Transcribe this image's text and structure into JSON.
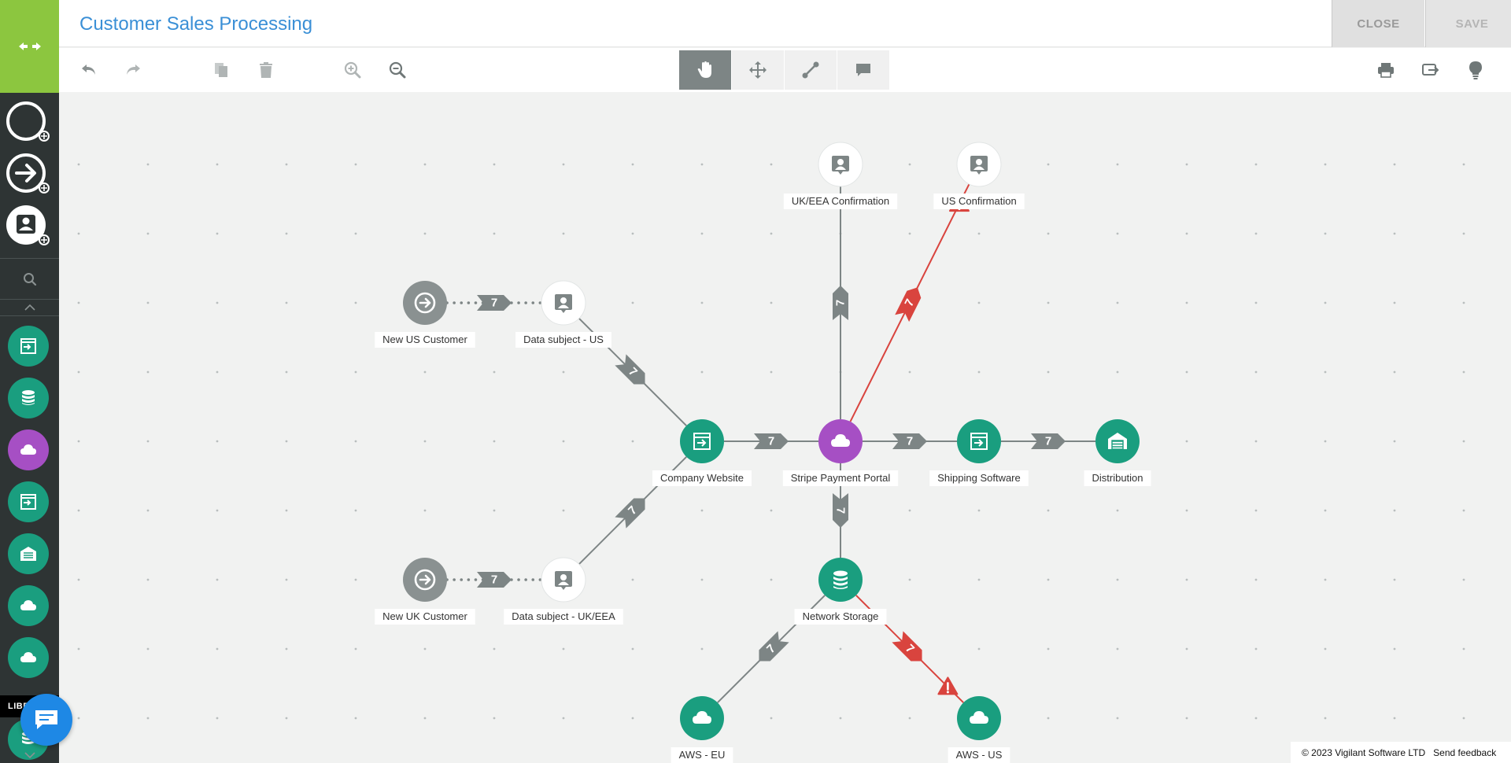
{
  "header": {
    "title": "Customer Sales Processing",
    "close_label": "CLOSE",
    "save_label": "SAVE"
  },
  "toolbar": {
    "left_icons": [
      "undo-icon",
      "redo-icon",
      "copy-icon",
      "delete-icon",
      "zoom-in-icon",
      "zoom-out-icon"
    ],
    "modes": [
      {
        "name": "pan",
        "icon": "hand-icon",
        "active": true
      },
      {
        "name": "move",
        "icon": "move-arrows-icon",
        "active": false
      },
      {
        "name": "connect",
        "icon": "connector-icon",
        "active": false
      },
      {
        "name": "comment",
        "icon": "comment-icon",
        "active": false
      }
    ],
    "right_icons": [
      "print-icon",
      "export-icon",
      "lightbulb-icon"
    ]
  },
  "sidebar": {
    "library_label": "LIBRARY",
    "shape_tools": [
      "circle-shape-icon",
      "arrow-circle-shape-icon",
      "person-shape-icon"
    ],
    "library_items": [
      {
        "icon": "application-icon",
        "color": "#1a9e7f"
      },
      {
        "icon": "database-icon",
        "color": "#1a9e7f"
      },
      {
        "icon": "cloud-icon",
        "color": "#a64fc4"
      },
      {
        "icon": "application-icon",
        "color": "#1a9e7f"
      },
      {
        "icon": "warehouse-icon",
        "color": "#1a9e7f"
      },
      {
        "icon": "cloud-icon",
        "color": "#1a9e7f"
      },
      {
        "icon": "cloud-icon",
        "color": "#1a9e7f"
      }
    ]
  },
  "colors": {
    "brand_green": "#8cc63f",
    "node_teal": "#1a9e7f",
    "node_purple": "#a64fc4",
    "node_gray": "#8a9191",
    "edge_gray": "#7d8585",
    "edge_red": "#d9443e",
    "title_blue": "#3a8fd6"
  },
  "diagram": {
    "nodes": [
      {
        "id": "new-us-customer",
        "label": "New US Customer",
        "type": "source",
        "icon": "arrow-right-icon",
        "color": "#8a9191"
      },
      {
        "id": "data-subject-us",
        "label": "Data subject - US",
        "type": "data-subject",
        "icon": "person-icon",
        "color": "#ffffff"
      },
      {
        "id": "new-uk-customer",
        "label": "New UK Customer",
        "type": "source",
        "icon": "arrow-right-icon",
        "color": "#8a9191"
      },
      {
        "id": "data-subject-uk-eea",
        "label": "Data subject - UK/EEA",
        "type": "data-subject",
        "icon": "person-icon",
        "color": "#ffffff"
      },
      {
        "id": "company-website",
        "label": "Company Website",
        "type": "application",
        "icon": "application-icon",
        "color": "#1a9e7f"
      },
      {
        "id": "stripe-payment-portal",
        "label": "Stripe Payment Portal",
        "type": "cloud",
        "icon": "cloud-icon",
        "color": "#a64fc4"
      },
      {
        "id": "shipping-software",
        "label": "Shipping Software",
        "type": "application",
        "icon": "application-icon",
        "color": "#1a9e7f"
      },
      {
        "id": "distribution",
        "label": "Distribution",
        "type": "warehouse",
        "icon": "warehouse-icon",
        "color": "#1a9e7f"
      },
      {
        "id": "uk-eea-confirmation",
        "label": "UK/EEA Confirmation",
        "type": "data-subject",
        "icon": "person-icon",
        "color": "#ffffff"
      },
      {
        "id": "us-confirmation",
        "label": "US Confirmation",
        "type": "data-subject",
        "icon": "person-icon",
        "color": "#ffffff"
      },
      {
        "id": "network-storage",
        "label": "Network Storage",
        "type": "database",
        "icon": "database-icon",
        "color": "#1a9e7f"
      },
      {
        "id": "aws-eu",
        "label": "AWS - EU",
        "type": "cloud",
        "icon": "cloud-icon",
        "color": "#1a9e7f"
      },
      {
        "id": "aws-us",
        "label": "AWS - US",
        "type": "cloud",
        "icon": "cloud-icon",
        "color": "#1a9e7f"
      }
    ],
    "edges": [
      {
        "from": "new-us-customer",
        "to": "data-subject-us",
        "label": "7",
        "style": "dotted",
        "warning": false
      },
      {
        "from": "new-uk-customer",
        "to": "data-subject-uk-eea",
        "label": "7",
        "style": "dotted",
        "warning": false
      },
      {
        "from": "data-subject-us",
        "to": "company-website",
        "label": "7",
        "style": "solid",
        "warning": false
      },
      {
        "from": "data-subject-uk-eea",
        "to": "company-website",
        "label": "7",
        "style": "solid",
        "warning": false
      },
      {
        "from": "company-website",
        "to": "stripe-payment-portal",
        "label": "7",
        "style": "solid",
        "warning": false
      },
      {
        "from": "stripe-payment-portal",
        "to": "shipping-software",
        "label": "7",
        "style": "solid",
        "warning": false
      },
      {
        "from": "shipping-software",
        "to": "distribution",
        "label": "7",
        "style": "solid",
        "warning": false
      },
      {
        "from": "stripe-payment-portal",
        "to": "uk-eea-confirmation",
        "label": "7",
        "style": "solid",
        "warning": false
      },
      {
        "from": "stripe-payment-portal",
        "to": "us-confirmation",
        "label": "7",
        "style": "solid",
        "warning": true
      },
      {
        "from": "stripe-payment-portal",
        "to": "network-storage",
        "label": "7",
        "style": "solid",
        "warning": false
      },
      {
        "from": "network-storage",
        "to": "aws-eu",
        "label": "7",
        "style": "solid",
        "warning": false
      },
      {
        "from": "network-storage",
        "to": "aws-us",
        "label": "7",
        "style": "solid",
        "warning": true
      }
    ]
  },
  "footer": {
    "copyright": "© 2023 Vigilant Software LTD",
    "feedback": "Send feedback"
  }
}
